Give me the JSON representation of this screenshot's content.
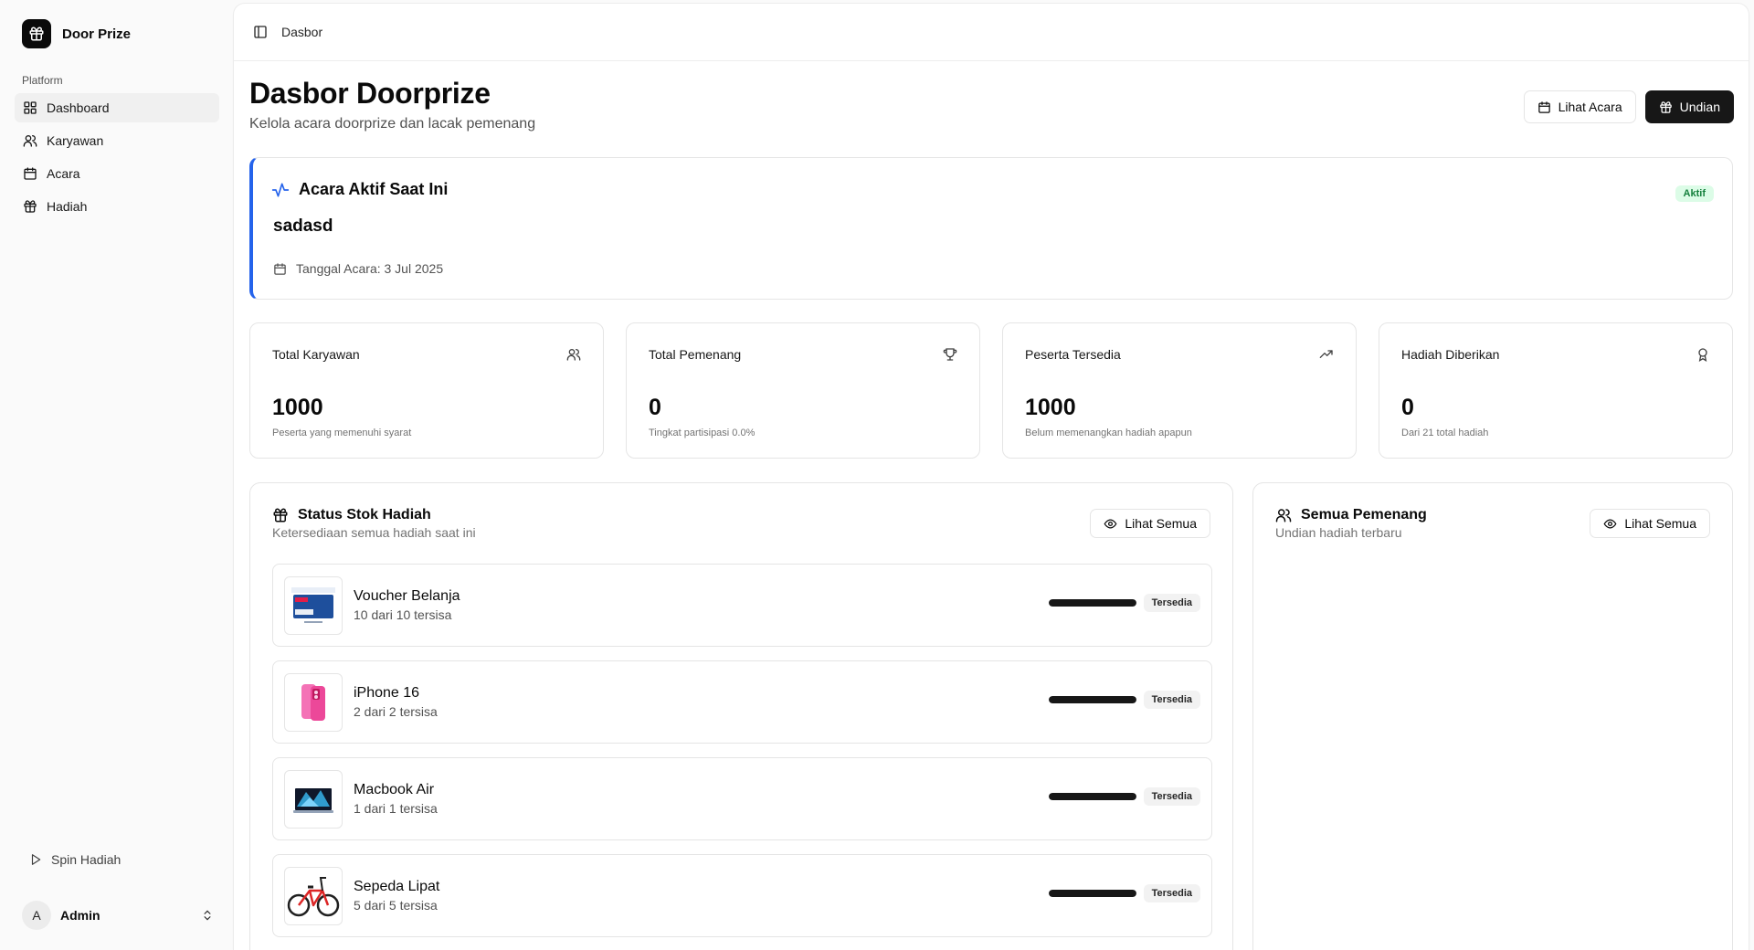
{
  "app": {
    "name": "Door Prize"
  },
  "sidebar": {
    "group_label": "Platform",
    "items": [
      {
        "label": "Dashboard",
        "icon": "dashboard-grid-icon",
        "active": true
      },
      {
        "label": "Karyawan",
        "icon": "user-icon"
      },
      {
        "label": "Acara",
        "icon": "calendar-icon"
      },
      {
        "label": "Hadiah",
        "icon": "gift-icon"
      }
    ],
    "spin_label": "Spin Hadiah",
    "user": {
      "initial": "A",
      "name": "Admin"
    }
  },
  "header": {
    "breadcrumb": "Dasbor"
  },
  "page": {
    "title": "Dasbor Doorprize",
    "subtitle": "Kelola acara doorprize dan lacak pemenang",
    "actions": {
      "view_event": "Lihat Acara",
      "draw": "Undian"
    }
  },
  "active_event": {
    "heading": "Acara Aktif Saat Ini",
    "name": "sadasd",
    "date_text": "Tanggal Acara: 3 Jul 2025",
    "status": "Aktif",
    "accent_color": "#2563eb"
  },
  "stats": [
    {
      "label": "Total Karyawan",
      "value": "1000",
      "desc": "Peserta yang memenuhi syarat",
      "icon": "users-icon"
    },
    {
      "label": "Total Pemenang",
      "value": "0",
      "desc": "Tingkat partisipasi 0.0%",
      "icon": "trophy-icon"
    },
    {
      "label": "Peserta Tersedia",
      "value": "1000",
      "desc": "Belum memenangkan hadiah apapun",
      "icon": "trending-up-icon"
    },
    {
      "label": "Hadiah Diberikan",
      "value": "0",
      "desc": "Dari 21 total hadiah",
      "icon": "award-icon"
    }
  ],
  "prize_stock": {
    "title": "Status Stok Hadiah",
    "subtitle": "Ketersediaan semua hadiah saat ini",
    "view_all": "Lihat Semua",
    "items": [
      {
        "name": "Voucher Belanja",
        "stock_text": "10 dari 10 tersisa",
        "remaining_fraction": 1.0,
        "status": "Tersedia",
        "thumb": "voucher-image"
      },
      {
        "name": "iPhone 16",
        "stock_text": "2 dari 2 tersisa",
        "remaining_fraction": 1.0,
        "status": "Tersedia",
        "thumb": "iphone-image"
      },
      {
        "name": "Macbook Air",
        "stock_text": "1 dari 1 tersisa",
        "remaining_fraction": 1.0,
        "status": "Tersedia",
        "thumb": "macbook-image"
      },
      {
        "name": "Sepeda Lipat",
        "stock_text": "5 dari 5 tersisa",
        "remaining_fraction": 1.0,
        "status": "Tersedia",
        "thumb": "bicycle-image"
      }
    ]
  },
  "winners": {
    "title": "Semua Pemenang",
    "subtitle": "Undian hadiah terbaru",
    "view_all": "Lihat Semua"
  }
}
